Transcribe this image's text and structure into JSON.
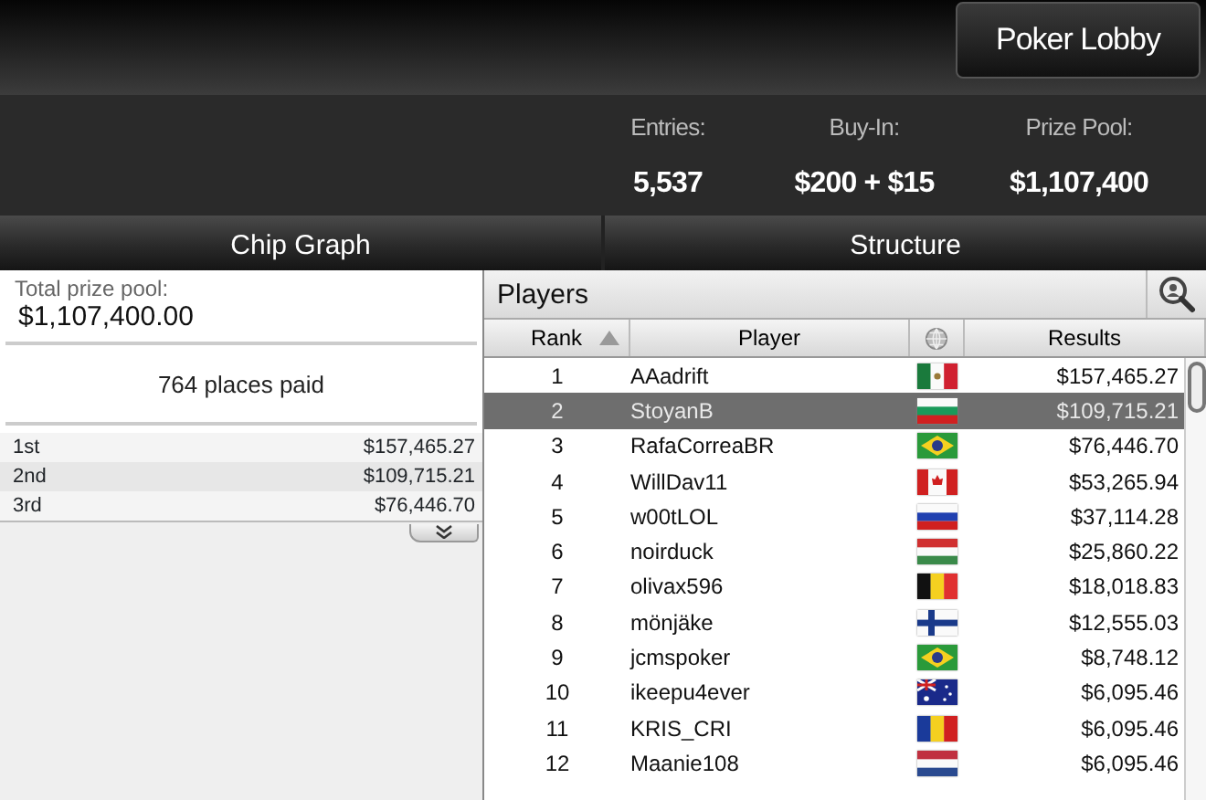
{
  "header": {
    "lobby_button": "Poker Lobby"
  },
  "stats": [
    {
      "label": "Entries:",
      "value": "5,537"
    },
    {
      "label": "Buy-In:",
      "value": "$200 + $15"
    },
    {
      "label": "Prize Pool:",
      "value": "$1,107,400"
    }
  ],
  "tabs": [
    {
      "label": "Chip Graph",
      "selected": false
    },
    {
      "label": "Structure",
      "selected": false
    }
  ],
  "prize_panel": {
    "total_label": "Total prize pool:",
    "total_value": "$1,107,400.00",
    "places_paid": "764 places paid",
    "payouts": [
      {
        "place": "1st",
        "amount": "$157,465.27"
      },
      {
        "place": "2nd",
        "amount": "$109,715.21"
      },
      {
        "place": "3rd",
        "amount": "$76,446.70"
      }
    ]
  },
  "players": {
    "title": "Players",
    "columns": [
      {
        "kind": "text",
        "label": "Rank",
        "sorted": true
      },
      {
        "kind": "text",
        "label": "Player",
        "sorted": false
      },
      {
        "kind": "globe",
        "sorted": false
      },
      {
        "kind": "text",
        "label": "Results",
        "sorted": false
      }
    ],
    "rows": [
      {
        "rank": "1",
        "player": "AAadrift",
        "kind": "mx",
        "result": "$157,465.27",
        "selected": false
      },
      {
        "rank": "2",
        "player": "StoyanB",
        "kind": "bg",
        "result": "$109,715.21",
        "selected": true
      },
      {
        "rank": "3",
        "player": "RafaCorreaBR",
        "kind": "br",
        "result": "$76,446.70",
        "selected": false
      },
      {
        "rank": "4",
        "player": "WillDav11",
        "kind": "ca",
        "result": "$53,265.94",
        "selected": false
      },
      {
        "rank": "5",
        "player": "w00tLOL",
        "kind": "ru",
        "result": "$37,114.28",
        "selected": false
      },
      {
        "rank": "6",
        "player": "noirduck",
        "kind": "hu",
        "result": "$25,860.22",
        "selected": false
      },
      {
        "rank": "7",
        "player": "olivax596",
        "kind": "be",
        "result": "$18,018.83",
        "selected": false
      },
      {
        "rank": "8",
        "player": "mönjäke",
        "kind": "fi",
        "result": "$12,555.03",
        "selected": false
      },
      {
        "rank": "9",
        "player": "jcmspoker",
        "kind": "br",
        "result": "$8,748.12",
        "selected": false
      },
      {
        "rank": "10",
        "player": "ikeepu4ever",
        "kind": "au",
        "result": "$6,095.46",
        "selected": false
      },
      {
        "rank": "11",
        "player": "KRIS_CRI",
        "kind": "ro",
        "result": "$6,095.46",
        "selected": false
      },
      {
        "rank": "12",
        "player": "Maanie108",
        "kind": "nl",
        "result": "$6,095.46",
        "selected": false
      }
    ]
  }
}
